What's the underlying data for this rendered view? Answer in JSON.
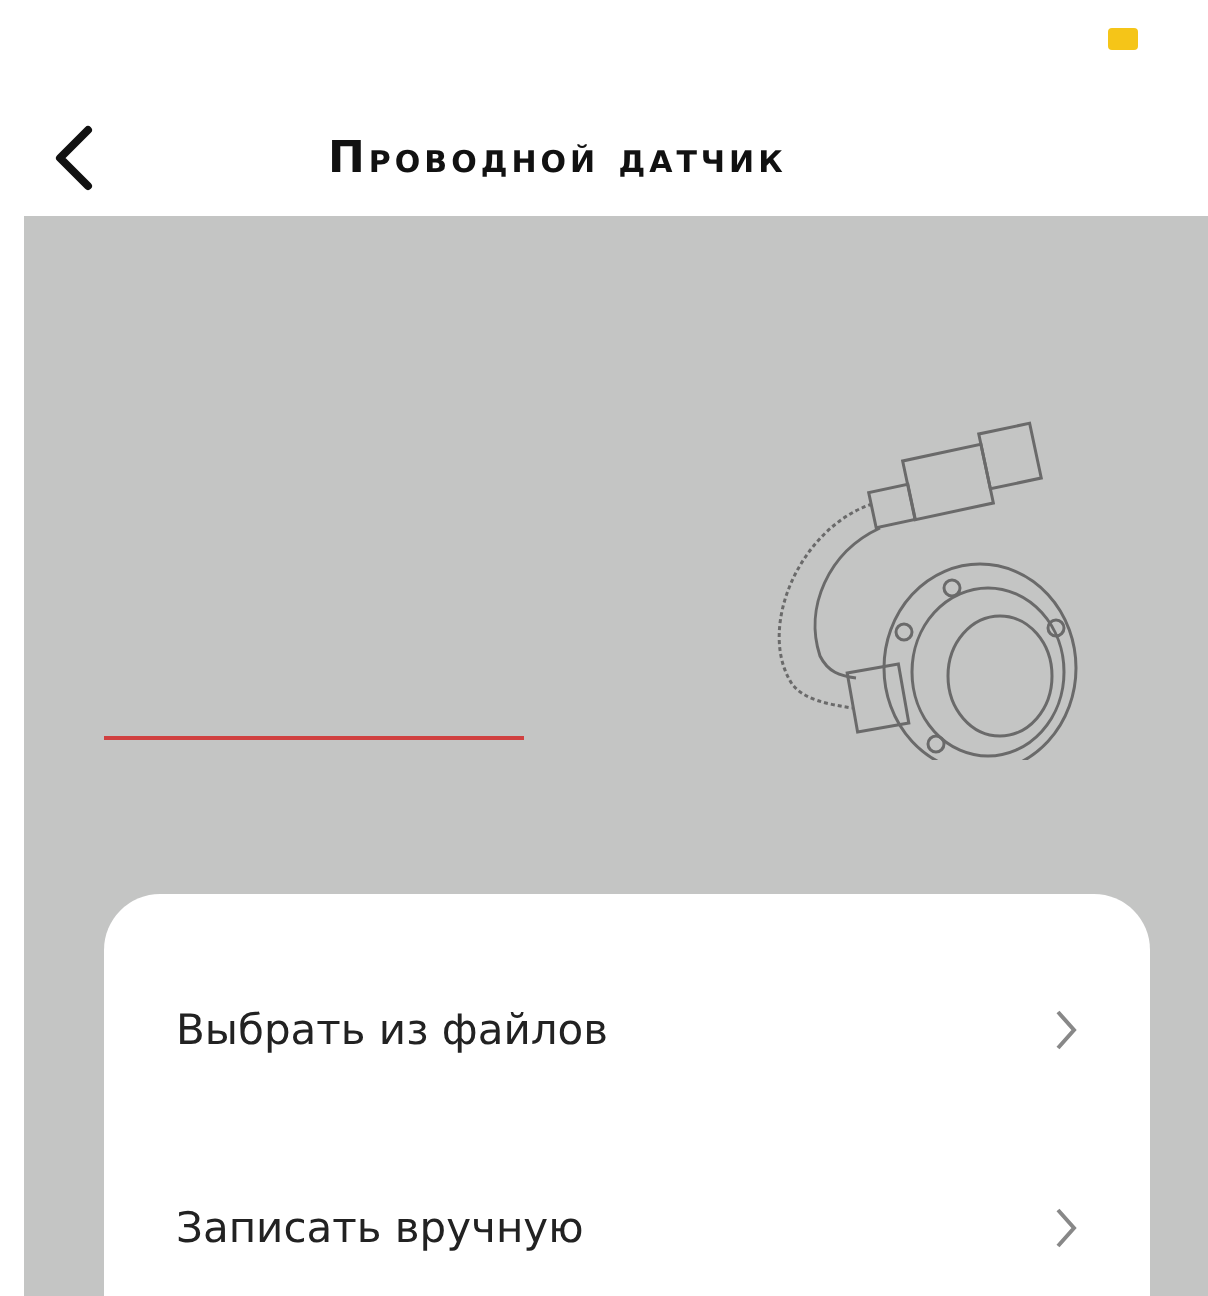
{
  "header": {
    "title": "Проводной датчик"
  },
  "sheet": {
    "options": [
      {
        "label": "Выбрать из файлов"
      },
      {
        "label": "Записать вручную"
      }
    ]
  }
}
